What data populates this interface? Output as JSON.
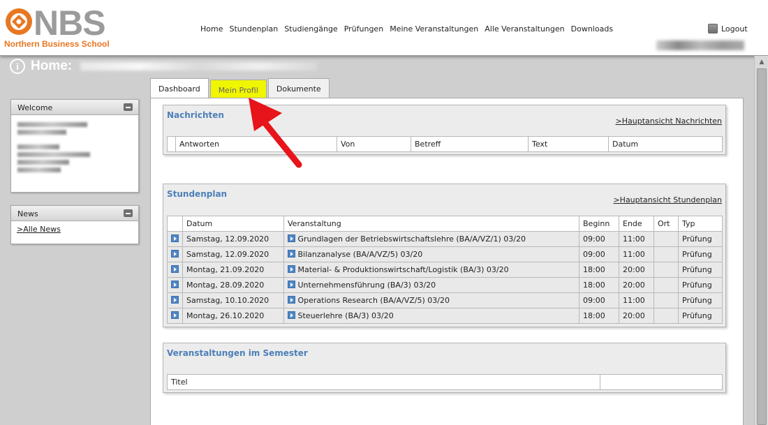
{
  "header": {
    "logo": {
      "letters": "NBS",
      "subtitle": "Northern Business School",
      "brand_color": "#e87722"
    },
    "nav": [
      "Home",
      "Stundenplan",
      "Studiengänge",
      "Prüfungen",
      "Meine Veranstaltungen",
      "Alle Veranstaltungen",
      "Downloads"
    ],
    "logout_label": "Logout"
  },
  "page": {
    "title": "Home:",
    "icon": "info-icon"
  },
  "sidebar": {
    "welcome": {
      "title": "Welcome"
    },
    "news": {
      "title": "News",
      "link": ">Alle News"
    }
  },
  "tabs": [
    "Dashboard",
    "Mein Profil",
    "Dokumente"
  ],
  "nachrichten": {
    "title": "Nachrichten",
    "link": ">Hauptansicht Nachrichten",
    "columns": [
      "Antworten",
      "Von",
      "Betreff",
      "Text",
      "Datum"
    ]
  },
  "stundenplan": {
    "title": "Stundenplan",
    "link": ">Hauptansicht Stundenplan",
    "columns": [
      "Datum",
      "Veranstaltung",
      "Beginn",
      "Ende",
      "Ort",
      "Typ"
    ],
    "rows": [
      {
        "datum": "Samstag, 12.09.2020",
        "veranstaltung": "Grundlagen der Betriebswirtschaftslehre (BA/A/VZ/1) 03/20",
        "beginn": "09:00",
        "ende": "11:00",
        "ort": "",
        "typ": "Prüfung"
      },
      {
        "datum": "Samstag, 12.09.2020",
        "veranstaltung": "Bilanzanalyse (BA/A/VZ/5) 03/20",
        "beginn": "09:00",
        "ende": "11:00",
        "ort": "",
        "typ": "Prüfung"
      },
      {
        "datum": "Montag, 21.09.2020",
        "veranstaltung": "Material- & Produktionswirtschaft/Logistik (BA/3) 03/20",
        "beginn": "18:00",
        "ende": "20:00",
        "ort": "",
        "typ": "Prüfung"
      },
      {
        "datum": "Montag, 28.09.2020",
        "veranstaltung": "Unternehmensführung (BA/3) 03/20",
        "beginn": "18:00",
        "ende": "20:00",
        "ort": "",
        "typ": "Prüfung"
      },
      {
        "datum": "Samstag, 10.10.2020",
        "veranstaltung": "Operations Research (BA/A/VZ/5) 03/20",
        "beginn": "09:00",
        "ende": "11:00",
        "ort": "",
        "typ": "Prüfung"
      },
      {
        "datum": "Montag, 26.10.2020",
        "veranstaltung": "Steuerlehre (BA/3) 03/20",
        "beginn": "18:00",
        "ende": "20:00",
        "ort": "",
        "typ": "Prüfung"
      }
    ]
  },
  "semester": {
    "title": "Veranstaltungen im Semester",
    "columns": [
      "Titel",
      ""
    ]
  },
  "colors": {
    "highlight_tab": "#f0f500",
    "section_title": "#4c7fb8",
    "annotation_arrow": "#e8141b"
  }
}
